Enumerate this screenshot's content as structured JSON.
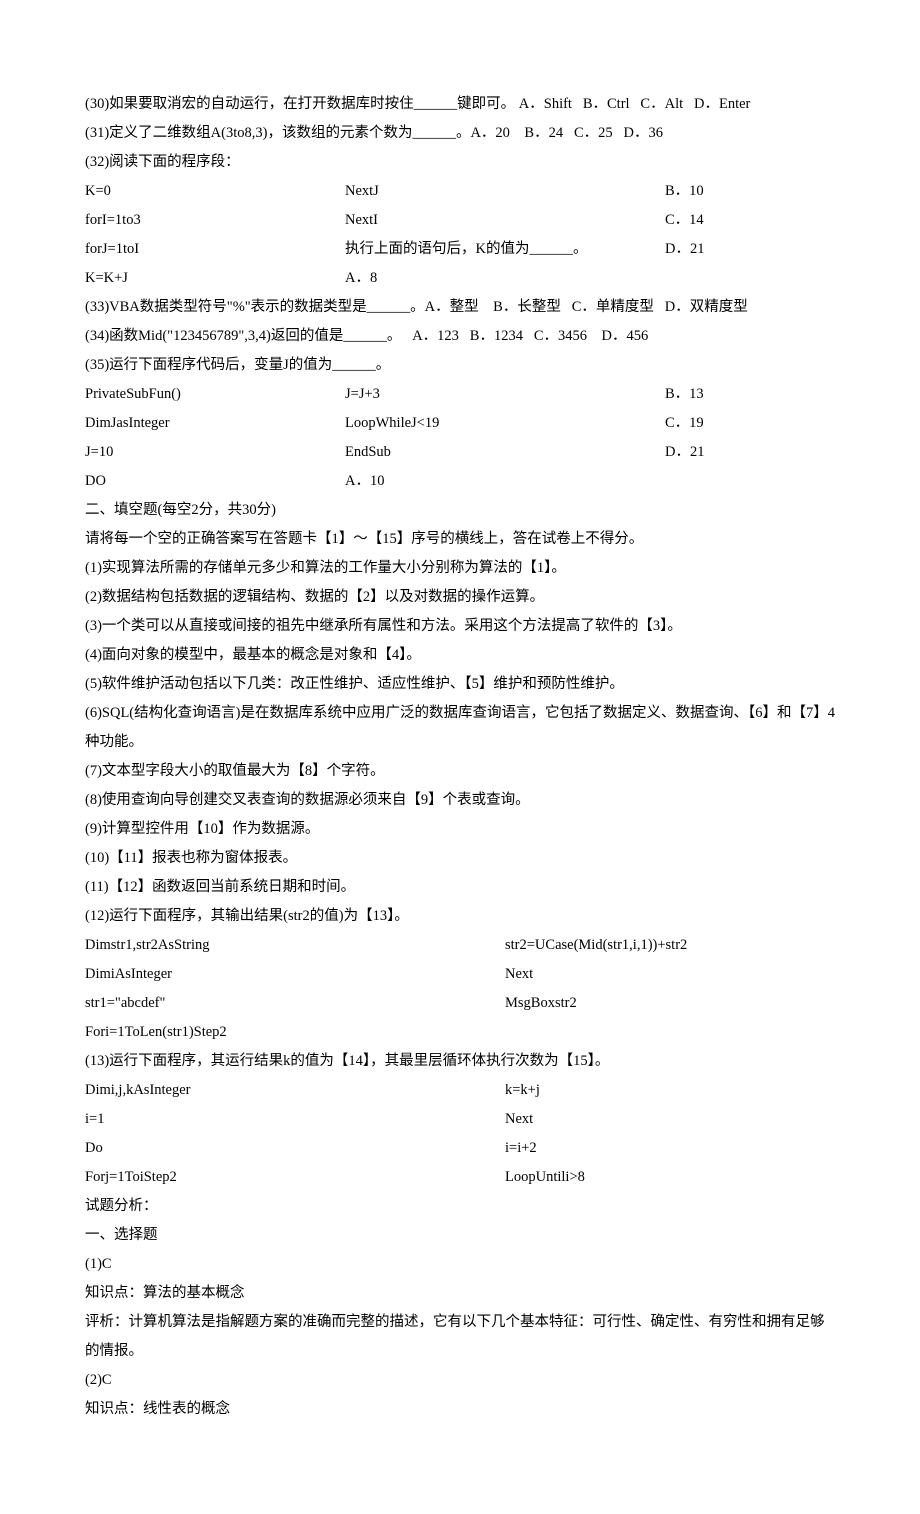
{
  "q30": "(30)如果要取消宏的自动运行，在打开数据库时按住______键即可。 A．Shift   B．Ctrl   C．Alt   D．Enter",
  "q31": "(31)定义了二维数组A(3to8,3)，该数组的元素个数为______。A．20    B．24   C．25   D．36",
  "q32_intro": "(32)阅读下面的程序段：",
  "q32_c1_1": "K=0",
  "q32_c1_2": "forI=1to3",
  "q32_c1_3": "forJ=1toI",
  "q32_c1_4": "K=K+J",
  "q32_c2_1": "NextJ",
  "q32_c2_2": "NextI",
  "q32_c2_3": "执行上面的语句后，K的值为______。",
  "q32_c2_4": "A．8",
  "q32_c3_1": "B．10",
  "q32_c3_2": "C．14",
  "q32_c3_3": "D．21",
  "q33": "(33)VBA数据类型符号\"%\"表示的数据类型是______。A．整型    B．长整型   C．单精度型   D．双精度型",
  "q34": "(34)函数Mid(\"123456789\",3,4)返回的值是______。   A．123   B．1234   C．3456    D．456",
  "q35_intro": "(35)运行下面程序代码后，变量J的值为______。",
  "q35_c1_1": "PrivateSubFun()",
  "q35_c1_2": "DimJasInteger",
  "q35_c1_3": "J=10",
  "q35_c1_4": "DO",
  "q35_c2_1": "J=J+3",
  "q35_c2_2": "LoopWhileJ<19",
  "q35_c2_3": "EndSub",
  "q35_c2_4": "A．10",
  "q35_c3_1": "B．13",
  "q35_c3_2": "C．19",
  "q35_c3_3": "D．21",
  "sec2_title": "二、填空题(每空2分，共30分)",
  "sec2_note": "请将每一个空的正确答案写在答题卡【1】～【15】序号的横线上，答在试卷上不得分。",
  "f1": "(1)实现算法所需的存储单元多少和算法的工作量大小分别称为算法的【1】。",
  "f2": "(2)数据结构包括数据的逻辑结构、数据的【2】以及对数据的操作运算。",
  "f3": "(3)一个类可以从直接或间接的祖先中继承所有属性和方法。采用这个方法提高了软件的【3】。",
  "f4": "(4)面向对象的模型中，最基本的概念是对象和【4】。",
  "f5": "(5)软件维护活动包括以下几类：改正性维护、适应性维护、【5】维护和预防性维护。",
  "f6": "(6)SQL(结构化查询语言)是在数据库系统中应用广泛的数据库查询语言，它包括了数据定义、数据查询、【6】和【7】4种功能。",
  "f7": "(7)文本型字段大小的取值最大为【8】个字符。",
  "f8": "(8)使用查询向导创建交叉表查询的数据源必须来自【9】个表或查询。",
  "f9": "(9)计算型控件用【10】作为数据源。",
  "f10": "(10)【11】报表也称为窗体报表。",
  "f11": "(11)【12】函数返回当前系统日期和时间。",
  "f12_intro": "(12)运行下面程序，其输出结果(str2的值)为【13】。",
  "f12_c1_1": "Dimstr1,str2AsString",
  "f12_c1_2": "DimiAsInteger",
  "f12_c1_3": "str1=\"abcdef\"",
  "f12_c1_4": "Fori=1ToLen(str1)Step2",
  "f12_c2_1": "str2=UCase(Mid(str1,i,1))+str2",
  "f12_c2_2": "Next",
  "f12_c2_3": "MsgBoxstr2",
  "f13_intro": "(13)运行下面程序，其运行结果k的值为【14】，其最里层循环体执行次数为【15】。",
  "f13_c1_1": "Dimi,j,kAsInteger",
  "f13_c1_2": "i=1",
  "f13_c1_3": "Do",
  "f13_c1_4": "Forj=1ToiStep2",
  "f13_c2_1": "k=k+j",
  "f13_c2_2": "Next",
  "f13_c2_3": "i=i+2",
  "f13_c2_4": "LoopUntili>8",
  "analysis_title": "试题分析：",
  "analysis_sec1": "一、选择题",
  "a1": "(1)C",
  "a1_kp": "知识点：算法的基本概念",
  "a1_ev": "评析：计算机算法是指解题方案的准确而完整的描述，它有以下几个基本特征：可行性、确定性、有穷性和拥有足够的情报。",
  "a2": "(2)C",
  "a2_kp": "知识点：线性表的概念"
}
